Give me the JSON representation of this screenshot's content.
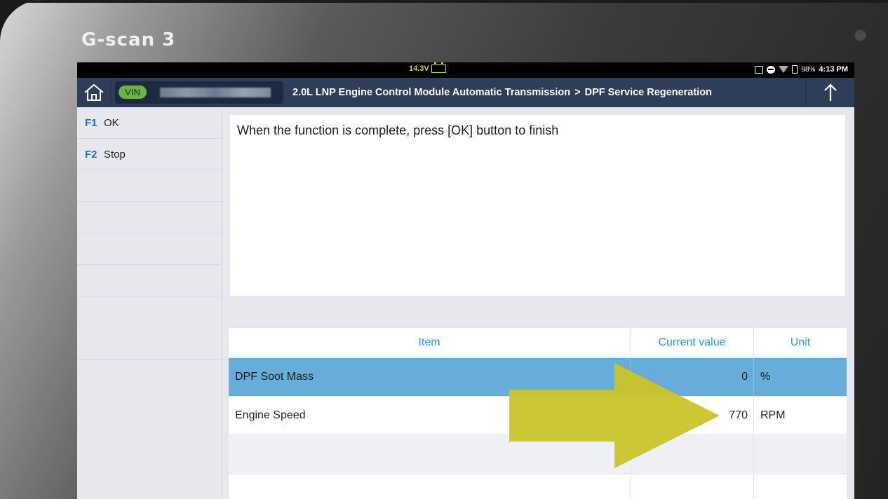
{
  "device": {
    "brand": "G-scan 3"
  },
  "statusbar": {
    "voltage": "14.3V",
    "battery_percent": "98%",
    "time": "4:13 PM"
  },
  "titlebar": {
    "vin_label": "VIN",
    "breadcrumb_module": "2.0L LNP Engine Control Module Automatic Transmission",
    "breadcrumb_separator": ">",
    "breadcrumb_function": "DPF Service Regeneration"
  },
  "sidebar": {
    "function_keys": [
      {
        "key": "F1",
        "label": "OK"
      },
      {
        "key": "F2",
        "label": "Stop"
      }
    ]
  },
  "message": "When the function is complete, press [OK] button to finish",
  "table": {
    "headers": {
      "item": "Item",
      "current_value": "Current value",
      "unit": "Unit"
    },
    "rows": [
      {
        "item": "DPF Soot Mass",
        "value": "0",
        "unit": "%",
        "selected": true
      },
      {
        "item": "Engine Speed",
        "value": "770",
        "unit": "RPM",
        "selected": false
      }
    ]
  },
  "colors": {
    "titlebar": "#2e3e58",
    "selected_row": "#66aed9",
    "header_text": "#3a96cf",
    "vin_badge": "#6db33f",
    "annotation_arrow": "#c8c42a"
  },
  "icons": {
    "home": "home-icon",
    "upload": "up-arrow-icon",
    "annotation": "arrow-annotation"
  }
}
